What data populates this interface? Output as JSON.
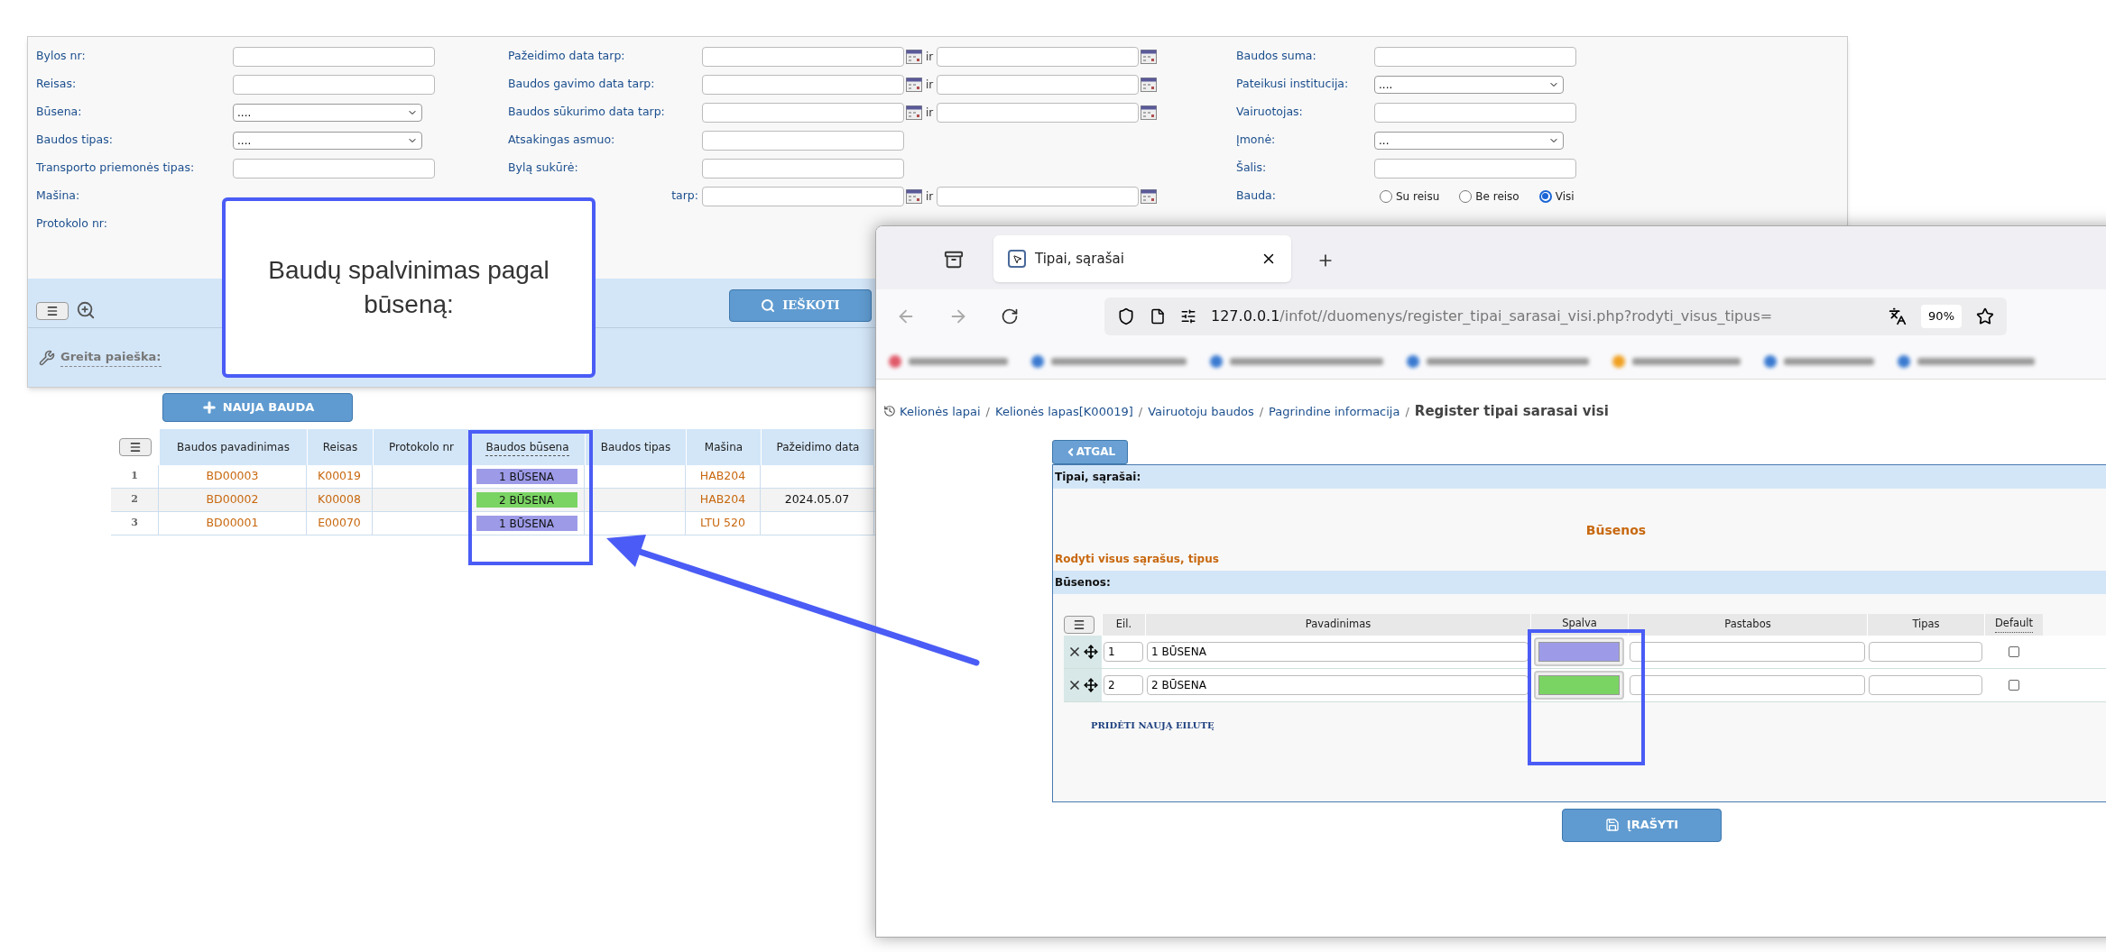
{
  "search_form": {
    "columns": [
      [
        {
          "label": "Bylos nr:",
          "kind": "text",
          "covered": false
        },
        {
          "label": "Reisas:",
          "kind": "text",
          "covered": false
        },
        {
          "label": "Būsena:",
          "kind": "select",
          "value": "....",
          "covered": false
        },
        {
          "label": "Baudos tipas:",
          "kind": "select",
          "value": "....",
          "covered": false
        },
        {
          "label": "Transporto priemonės tipas:",
          "kind": "text",
          "covered": false
        },
        {
          "label": "Mašina:",
          "kind": "none",
          "covered": false
        },
        {
          "label": "Protokolo nr:",
          "kind": "none",
          "covered": false
        }
      ],
      [
        {
          "label": "Pažeidimo data tarp:",
          "kind": "date_range",
          "joiner": "ir",
          "covered": false
        },
        {
          "label": "Baudos gavimo data tarp:",
          "kind": "date_range",
          "joiner": "ir",
          "covered": false
        },
        {
          "label": "Baudos sūkurimo data tarp:",
          "kind": "date_range",
          "joiner": "ir",
          "covered": false
        },
        {
          "label": "Atsakingas asmuo:",
          "kind": "text",
          "covered": false
        },
        {
          "label": "Bylą sukūrė:",
          "kind": "text",
          "covered": false
        },
        {
          "label": "tarp:",
          "kind": "date_range",
          "joiner": "ir",
          "covered": true
        }
      ],
      [
        {
          "label": "Baudos suma:",
          "kind": "text",
          "covered": false
        },
        {
          "label": "Pateikusi institucija:",
          "kind": "select",
          "value": "....",
          "covered": false
        },
        {
          "label": "Vairuotojas:",
          "kind": "text",
          "covered": false
        },
        {
          "label": "Įmonė:",
          "kind": "select",
          "value": "...",
          "covered": false
        },
        {
          "label": "Šalis:",
          "kind": "text",
          "covered": false
        },
        {
          "label": "Bauda:",
          "kind": "radio",
          "options": [
            {
              "label": "Su reisu",
              "selected": false
            },
            {
              "label": "Be reiso",
              "selected": false
            },
            {
              "label": "Visi",
              "selected": true
            }
          ],
          "covered": false
        }
      ]
    ],
    "search_button": "IEŠKOTI",
    "quick_search": "Greita paieška:"
  },
  "new_button": "NAUJA BAUDA",
  "table": {
    "columns": [
      "Baudos pavadinimas",
      "Reisas",
      "Protokolo nr",
      "Baudos būsena",
      "Baudos tipas",
      "Mašina",
      "Pažeidimo data"
    ],
    "rows": [
      {
        "index": "1",
        "name": "BD00003",
        "trip": "K00019",
        "status": {
          "label": "1 BŪSENA",
          "color": "#9d9be8"
        },
        "car": "HAB204"
      },
      {
        "index": "2",
        "name": "BD00002",
        "trip": "K00008",
        "status": {
          "label": "2 BŪSENA",
          "color": "#7ad463"
        },
        "car": "HAB204",
        "date": "2024.05.07"
      },
      {
        "index": "3",
        "name": "BD00001",
        "trip": "E00070",
        "status": {
          "label": "1 BŪSENA",
          "color": "#9d9be8"
        },
        "car": "LTU 520"
      }
    ]
  },
  "callout": "Baudų spalvinimas pagal būseną:",
  "browser": {
    "tab_title": "Tipai, sąrašai",
    "url_host": "127.0.0.1",
    "url_path": "/infot//duomenys/register_tipai_sarasai_visi.php?rodyti_visus_tipus=",
    "zoom": "90%",
    "breadcrumb_separator": "/",
    "breadcrumb": [
      {
        "label": "Kelionės lapai",
        "current": false
      },
      {
        "label": "Kelionės lapas[K00019]",
        "current": false
      },
      {
        "label": "Vairuotoju baudos",
        "current": false
      },
      {
        "label": "Pagrindine informacija",
        "current": false
      },
      {
        "label": "Register tipai sarasai visi",
        "current": true
      }
    ],
    "back_button": "ATGAL",
    "panel_title": "Tipai, sąrašai:",
    "heading": "Būsenos",
    "show_all_link": "Rodyti visus sąrašus, tipus",
    "section_title": "Būsenos:",
    "table": {
      "columns": [
        "Eil.",
        "Pavadinimas",
        "Spalva",
        "Pastabos",
        "Tipas",
        "Default"
      ],
      "rows": [
        {
          "order": "1",
          "name": "1 BŪSENA",
          "color": "#9d9be8",
          "default": false
        },
        {
          "order": "2",
          "name": "2 BŪSENA",
          "color": "#7ad463",
          "default": false
        }
      ]
    },
    "add_row_link": "PRIDĖTI NAUJĄ EILUTĘ",
    "save_button": "ĮRAŠYTI"
  }
}
